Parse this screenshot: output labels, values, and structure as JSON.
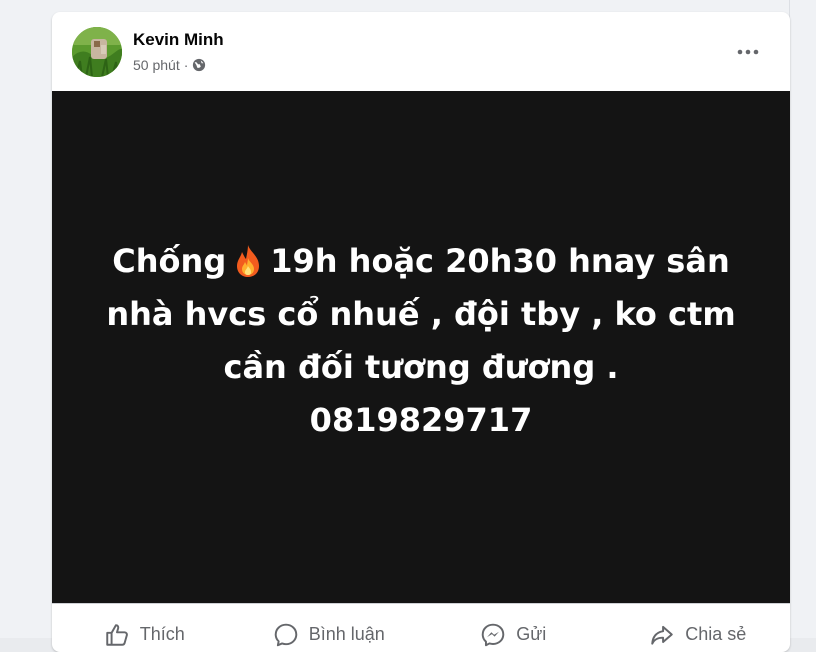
{
  "post": {
    "author": "Kevin Minh",
    "time": "50 phút",
    "separator": "·",
    "audience_icon": "globe-icon",
    "more_icon": "more-options-icon",
    "text_before_emoji": "Chống",
    "emoji": "fire-icon",
    "text_line1_rest": "19h hoặc 20h30 hnay sân",
    "text_line2": "nhà hvcs cổ nhuế , đội tby , ko ctm",
    "text_line3": "cần đối tương đương .",
    "text_line4": "0819829717",
    "background_color": "#141414"
  },
  "actions": {
    "like": {
      "label": "Thích",
      "icon": "thumbs-up-icon"
    },
    "comment": {
      "label": "Bình luận",
      "icon": "comment-icon"
    },
    "send": {
      "label": "Gửi",
      "icon": "messenger-icon"
    },
    "share": {
      "label": "Chia sẻ",
      "icon": "share-icon"
    }
  }
}
